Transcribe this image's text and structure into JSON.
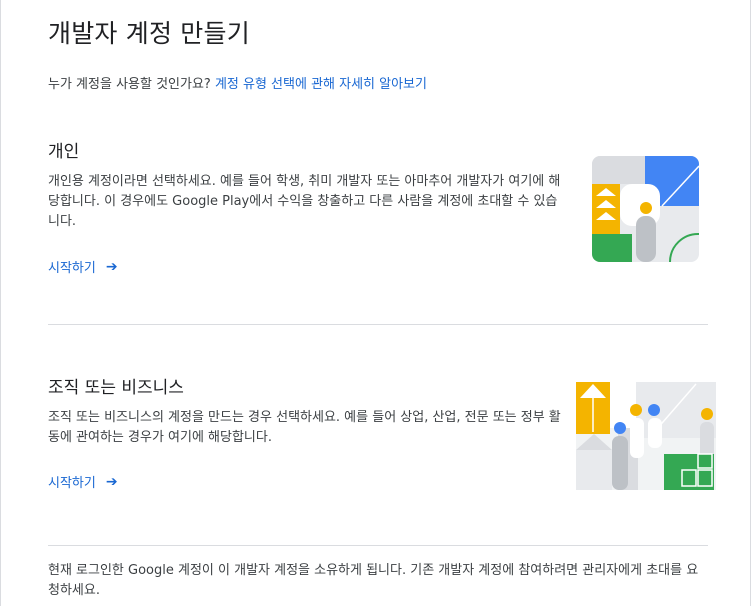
{
  "header": {
    "title": "개발자 계정 만들기"
  },
  "intro": {
    "question": "누가 계정을 사용할 것인가요? ",
    "link": "계정 유형 선택에 관해 자세히 알아보기"
  },
  "sections": [
    {
      "title": "개인",
      "description": "개인용 계정이라면 선택하세요. 예를 들어 학생, 취미 개발자 또는 아마추어 개발자가 여기에 해당합니다. 이 경우에도 Google Play에서 수익을 창출하고 다른 사람을 계정에 초대할 수 있습니다.",
      "start_label": "시작하기",
      "illustration_icon": "personal-illustration"
    },
    {
      "title": "조직 또는 비즈니스",
      "description": "조직 또는 비즈니스의 계정을 만드는 경우 선택하세요. 예를 들어 상업, 산업, 전문 또는 정부 활동에 관여하는 경우가 여기에 해당합니다.",
      "start_label": "시작하기",
      "illustration_icon": "organization-illustration"
    }
  ],
  "footer": {
    "text": "현재 로그인한 Google 계정이 이 개발자 계정을 소유하게 됩니다. 기존 개발자 계정에 참여하려면 관리자에게 초대를 요청하세요."
  },
  "colors": {
    "link": "#1967d2",
    "blue": "#4285f4",
    "yellow": "#f4b400",
    "green": "#34a853",
    "gray": "#dadce0"
  }
}
